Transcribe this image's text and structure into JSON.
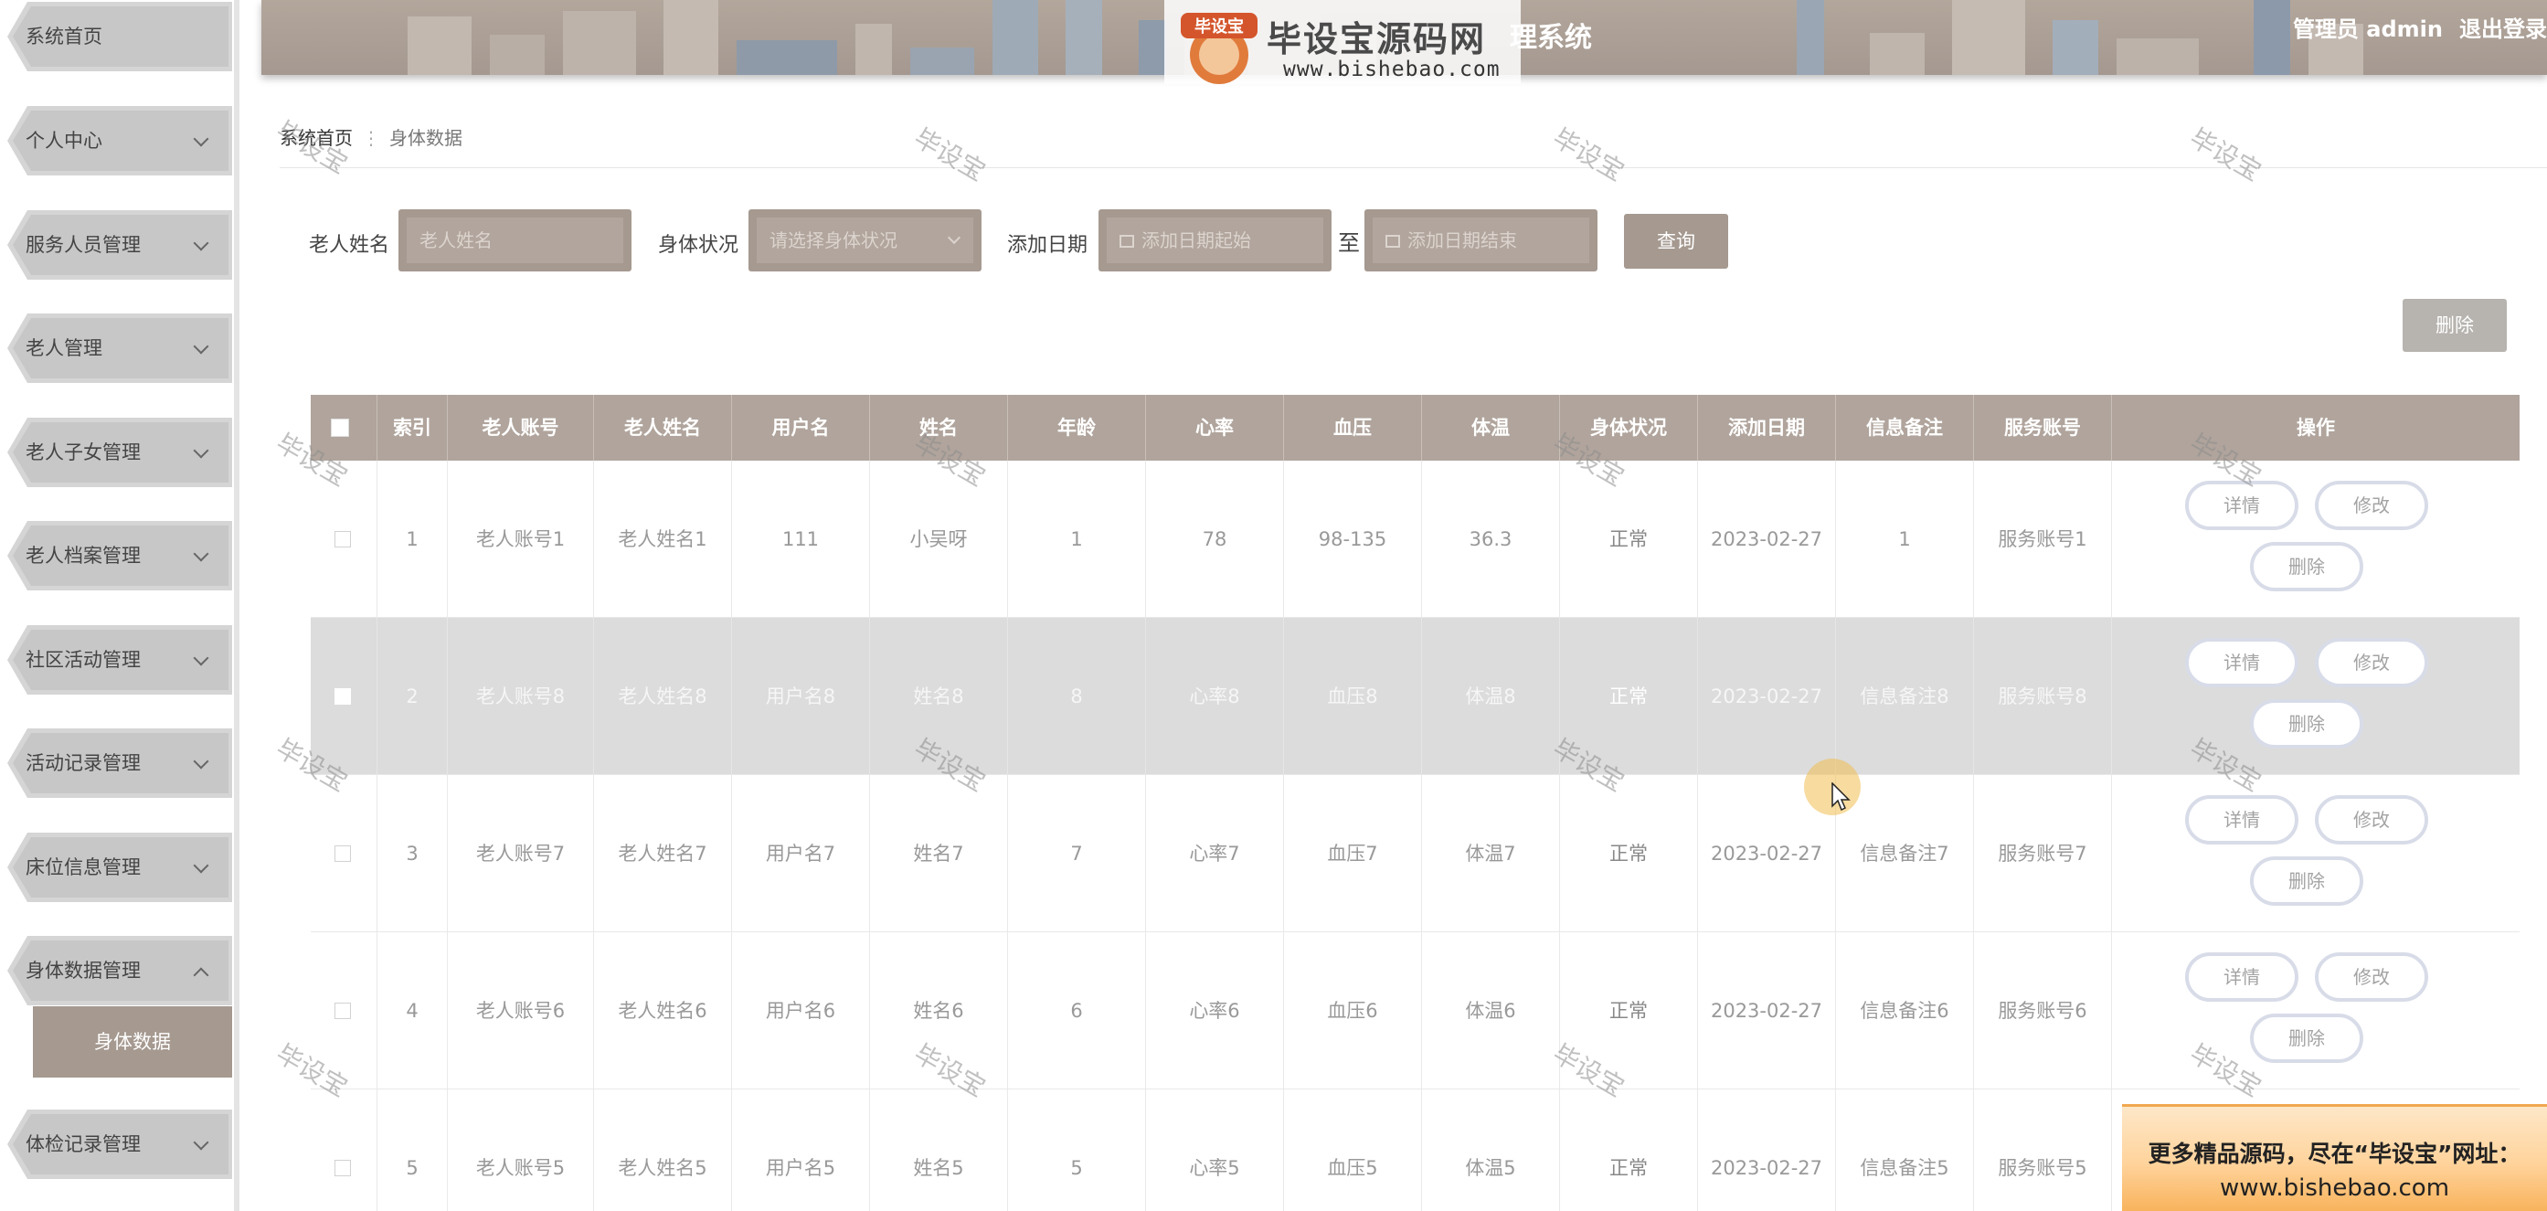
{
  "header": {
    "logo_badge": "毕设宝",
    "logo_title": "毕设宝源码网",
    "title_tail": "理系统",
    "logo_url": "www.bishebao.com",
    "user_label": "管理员 admin",
    "logout_label": "退出登录"
  },
  "sidebar": {
    "items": [
      {
        "label": "系统首页"
      },
      {
        "label": "个人中心"
      },
      {
        "label": "服务人员管理"
      },
      {
        "label": "老人管理"
      },
      {
        "label": "老人子女管理"
      },
      {
        "label": "老人档案管理"
      },
      {
        "label": "社区活动管理"
      },
      {
        "label": "活动记录管理"
      },
      {
        "label": "床位信息管理"
      },
      {
        "label": "身体数据管理"
      },
      {
        "label": "体检记录管理"
      }
    ],
    "sub_active": "身体数据"
  },
  "breadcrumb": {
    "home": "系统首页",
    "separator": "⋮",
    "current": "身体数据"
  },
  "search": {
    "name_label": "老人姓名",
    "name_placeholder": "老人姓名",
    "status_label": "身体状况",
    "status_placeholder": "请选择身体状况",
    "date_label": "添加日期",
    "date_start_placeholder": "添加日期起始",
    "date_to": "至",
    "date_end_placeholder": "添加日期结束",
    "query_button": "查询"
  },
  "toolbar": {
    "delete_button": "删除"
  },
  "table": {
    "columns": [
      "索引",
      "老人账号",
      "老人姓名",
      "用户名",
      "姓名",
      "年龄",
      "心率",
      "血压",
      "体温",
      "身体状况",
      "添加日期",
      "信息备注",
      "服务账号",
      "操作"
    ],
    "rows": [
      {
        "index": "1",
        "account": "老人账号1",
        "name": "老人姓名1",
        "username": "111",
        "realname": "小吴呀",
        "age": "1",
        "heart": "78",
        "pressure": "98-135",
        "temp": "36.3",
        "status": "正常",
        "date": "2023-02-27",
        "note": "1",
        "service": "服务账号1"
      },
      {
        "index": "2",
        "account": "老人账号8",
        "name": "老人姓名8",
        "username": "用户名8",
        "realname": "姓名8",
        "age": "8",
        "heart": "心率8",
        "pressure": "血压8",
        "temp": "体温8",
        "status": "正常",
        "date": "2023-02-27",
        "note": "信息备注8",
        "service": "服务账号8"
      },
      {
        "index": "3",
        "account": "老人账号7",
        "name": "老人姓名7",
        "username": "用户名7",
        "realname": "姓名7",
        "age": "7",
        "heart": "心率7",
        "pressure": "血压7",
        "temp": "体温7",
        "status": "正常",
        "date": "2023-02-27",
        "note": "信息备注7",
        "service": "服务账号7"
      },
      {
        "index": "4",
        "account": "老人账号6",
        "name": "老人姓名6",
        "username": "用户名6",
        "realname": "姓名6",
        "age": "6",
        "heart": "心率6",
        "pressure": "血压6",
        "temp": "体温6",
        "status": "正常",
        "date": "2023-02-27",
        "note": "信息备注6",
        "service": "服务账号6"
      },
      {
        "index": "5",
        "account": "老人账号5",
        "name": "老人姓名5",
        "username": "用户名5",
        "realname": "姓名5",
        "age": "5",
        "heart": "心率5",
        "pressure": "血压5",
        "temp": "体温5",
        "status": "正常",
        "date": "2023-02-27",
        "note": "信息备注5",
        "service": "服务账号5"
      }
    ],
    "actions": {
      "detail": "详情",
      "edit": "修改",
      "delete": "删除"
    }
  },
  "watermark": "毕设宝",
  "ad": {
    "line1": "更多精品源码，尽在“毕设宝”网址：",
    "line2": "www.bishebao.com"
  },
  "colors": {
    "accent": "#a59990",
    "table_header": "#b0a49c",
    "header_bg": "#aa9e95"
  }
}
